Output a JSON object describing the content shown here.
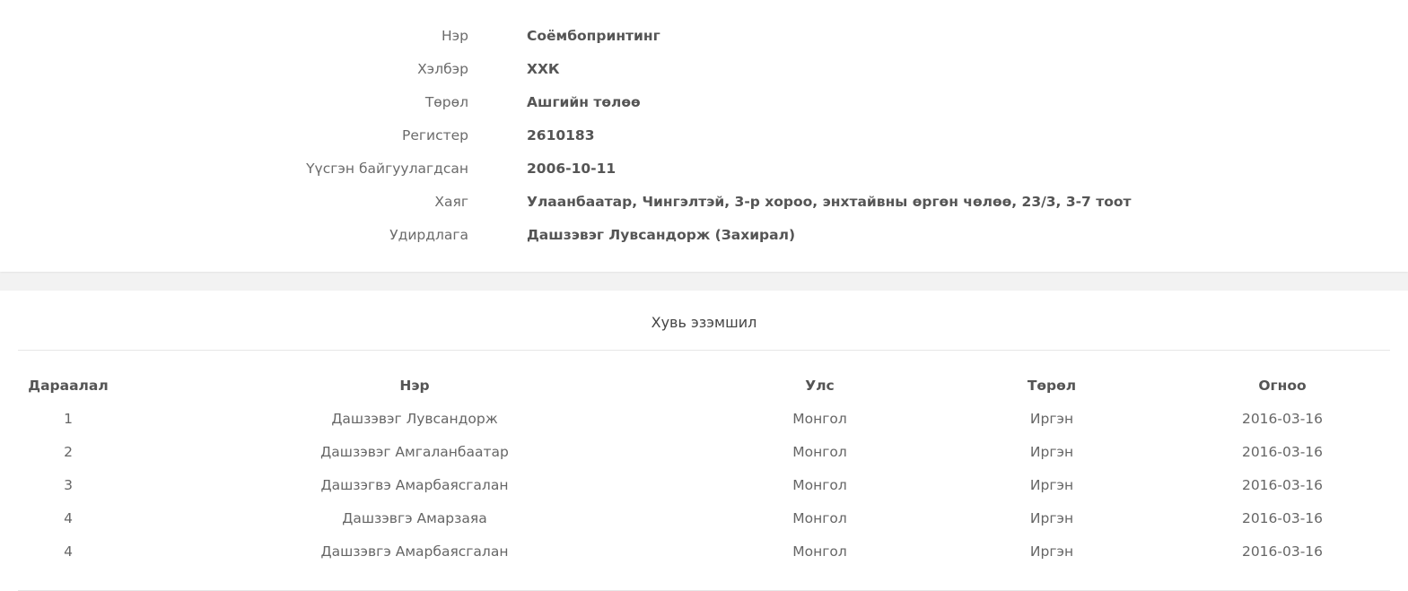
{
  "company_info": {
    "rows": [
      {
        "label": "Нэр",
        "value": "Соёмбопринтинг"
      },
      {
        "label": "Хэлбэр",
        "value": "ХХК"
      },
      {
        "label": "Төрөл",
        "value": "Ашгийн төлөө"
      },
      {
        "label": "Регистер",
        "value": "2610183"
      },
      {
        "label": "Үүсгэн байгуулагдсан",
        "value": "2006-10-11"
      },
      {
        "label": "Хаяг",
        "value": "Улаанбаатар, Чингэлтэй, 3-р хороо, энхтайвны өргөн чөлөө, 23/3, 3-7 тоот"
      },
      {
        "label": "Удирдлага",
        "value": "Дашзэвэг Лувсандорж (Захирал)"
      }
    ]
  },
  "ownership": {
    "title": "Хувь эзэмшил",
    "headers": {
      "seq": "Дараалал",
      "name": "Нэр",
      "country": "Улс",
      "type": "Төрөл",
      "date": "Огноо"
    },
    "rows": [
      {
        "seq": "1",
        "name": "Дашзэвэг Лувсандорж",
        "country": "Монгол",
        "type": "Иргэн",
        "date": "2016-03-16"
      },
      {
        "seq": "2",
        "name": "Дашзэвэг Амгаланбаатар",
        "country": "Монгол",
        "type": "Иргэн",
        "date": "2016-03-16"
      },
      {
        "seq": "3",
        "name": "Дашзэгвэ Амарбаясгалан",
        "country": "Монгол",
        "type": "Иргэн",
        "date": "2016-03-16"
      },
      {
        "seq": "4",
        "name": "Дашзэвгэ Амарзаяа",
        "country": "Монгол",
        "type": "Иргэн",
        "date": "2016-03-16"
      },
      {
        "seq": "4",
        "name": "Дашзэвгэ Амарбаясгалан",
        "country": "Монгол",
        "type": "Иргэн",
        "date": "2016-03-16"
      }
    ]
  }
}
